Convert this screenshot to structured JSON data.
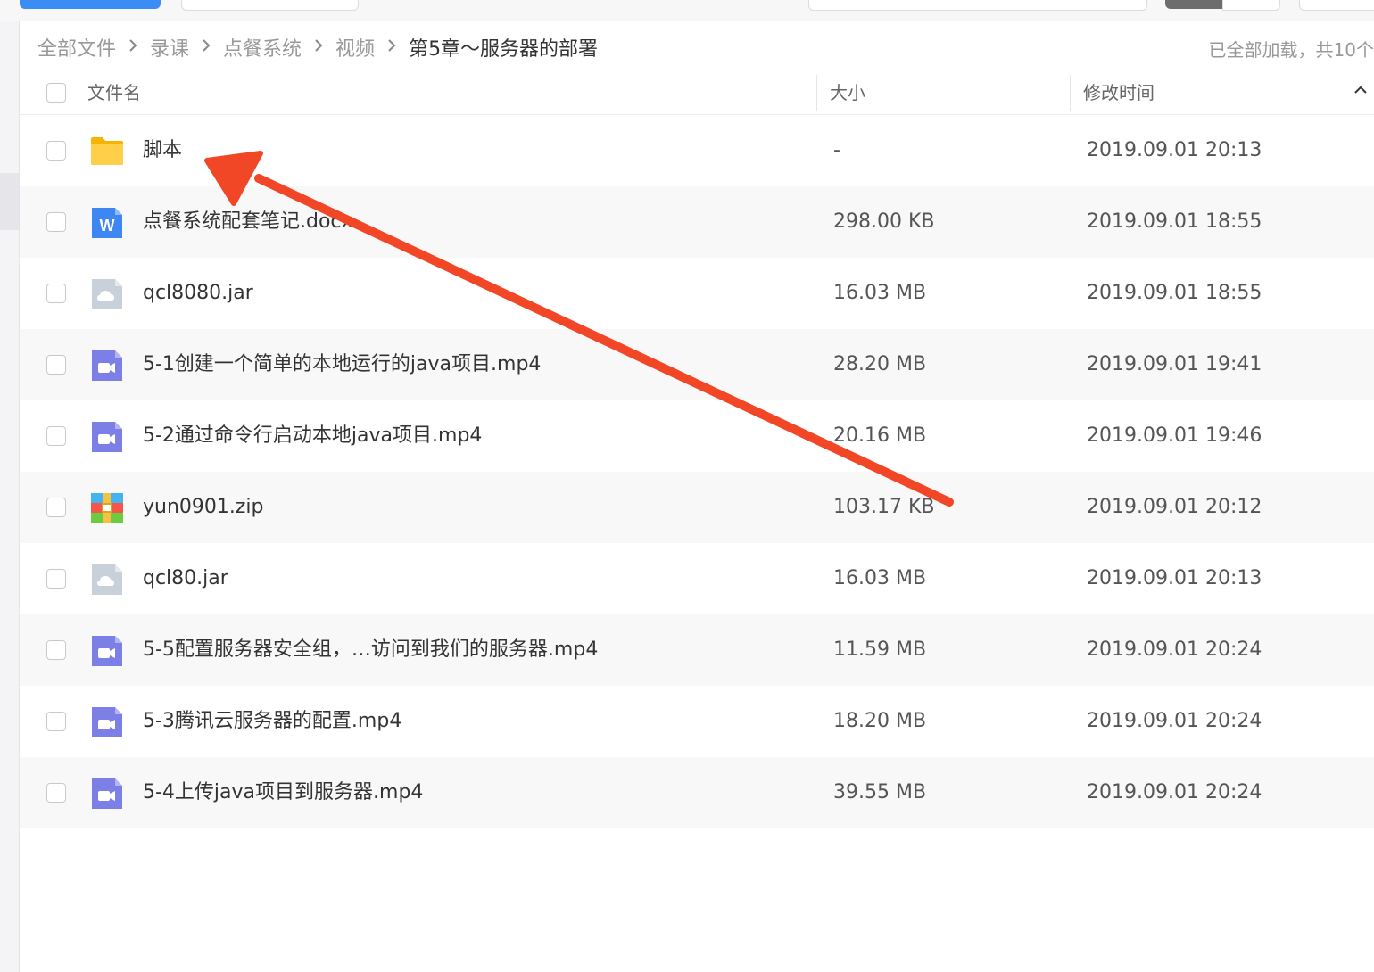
{
  "breadcrumb": {
    "items": [
      "全部文件",
      "录课",
      "点餐系统",
      "视频",
      "第5章～服务器的部署"
    ],
    "separator": "›"
  },
  "status": {
    "loaded_text": "已全部加载，共10个"
  },
  "table": {
    "columns": {
      "name": "文件名",
      "size": "大小",
      "modified": "修改时间"
    },
    "rows": [
      {
        "name": "脚本",
        "size": "-",
        "modified": "2019.09.01 20:13",
        "icon": "folder-icon"
      },
      {
        "name": "点餐系统配套笔记.docx",
        "size": "298.00 KB",
        "modified": "2019.09.01 18:55",
        "icon": "word-doc-icon"
      },
      {
        "name": "qcl8080.jar",
        "size": "16.03 MB",
        "modified": "2019.09.01 18:55",
        "icon": "generic-file-icon"
      },
      {
        "name": "5-1创建一个简单的本地运行的java项目.mp4",
        "size": "28.20 MB",
        "modified": "2019.09.01 19:41",
        "icon": "video-icon"
      },
      {
        "name": "5-2通过命令行启动本地java项目.mp4",
        "size": "20.16 MB",
        "modified": "2019.09.01 19:46",
        "icon": "video-icon"
      },
      {
        "name": "yun0901.zip",
        "size": "103.17 KB",
        "modified": "2019.09.01 20:12",
        "icon": "zip-icon"
      },
      {
        "name": "qcl80.jar",
        "size": "16.03 MB",
        "modified": "2019.09.01 20:13",
        "icon": "generic-file-icon"
      },
      {
        "name": "5-5配置服务器安全组，…访问到我们的服务器.mp4",
        "size": "11.59 MB",
        "modified": "2019.09.01 20:24",
        "icon": "video-icon"
      },
      {
        "name": "5-3腾讯云服务器的配置.mp4",
        "size": "18.20 MB",
        "modified": "2019.09.01 20:24",
        "icon": "video-icon"
      },
      {
        "name": "5-4上传java项目到服务器.mp4",
        "size": "39.55 MB",
        "modified": "2019.09.01 20:24",
        "icon": "video-icon"
      }
    ]
  },
  "colors": {
    "accent": "#3b8cf5",
    "folder": "#ffc73a",
    "video": "#7b7fe6",
    "word": "#3e86f1",
    "annotation_arrow": "#f24726"
  }
}
